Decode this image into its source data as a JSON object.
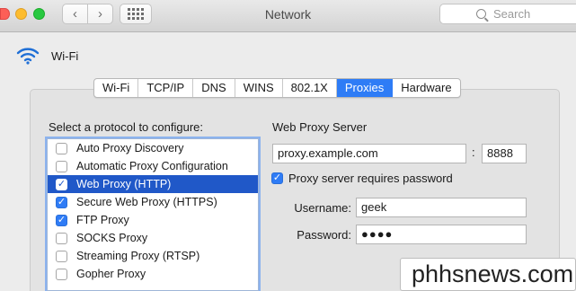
{
  "window": {
    "title": "Network"
  },
  "toolbar": {
    "back_icon": "chevron-left-icon",
    "forward_icon": "chevron-right-icon",
    "show_all_icon": "grid-icon"
  },
  "search": {
    "placeholder": "Search"
  },
  "interface": {
    "name": "Wi-Fi",
    "icon": "wifi-icon"
  },
  "tabs": [
    {
      "label": "Wi-Fi",
      "active": false
    },
    {
      "label": "TCP/IP",
      "active": false
    },
    {
      "label": "DNS",
      "active": false
    },
    {
      "label": "WINS",
      "active": false
    },
    {
      "label": "802.1X",
      "active": false
    },
    {
      "label": "Proxies",
      "active": true
    },
    {
      "label": "Hardware",
      "active": false
    }
  ],
  "protocols": {
    "heading": "Select a protocol to configure:",
    "items": [
      {
        "label": "Auto Proxy Discovery",
        "checked": false,
        "selected": false
      },
      {
        "label": "Automatic Proxy Configuration",
        "checked": false,
        "selected": false
      },
      {
        "label": "Web Proxy (HTTP)",
        "checked": true,
        "selected": true
      },
      {
        "label": "Secure Web Proxy (HTTPS)",
        "checked": true,
        "selected": false
      },
      {
        "label": "FTP Proxy",
        "checked": true,
        "selected": false
      },
      {
        "label": "SOCKS Proxy",
        "checked": false,
        "selected": false
      },
      {
        "label": "Streaming Proxy (RTSP)",
        "checked": false,
        "selected": false
      },
      {
        "label": "Gopher Proxy",
        "checked": false,
        "selected": false
      }
    ]
  },
  "web_proxy": {
    "heading": "Web Proxy Server",
    "server": "proxy.example.com",
    "colon": ":",
    "port": "8888",
    "requires_password_label": "Proxy server requires password",
    "requires_password": true,
    "username_label": "Username:",
    "username": "geek",
    "password_label": "Password:",
    "password": "●●●●"
  },
  "watermark": "phhsnews.com",
  "colors": {
    "accent": "#2e7cf6",
    "selection": "#2058c8"
  }
}
